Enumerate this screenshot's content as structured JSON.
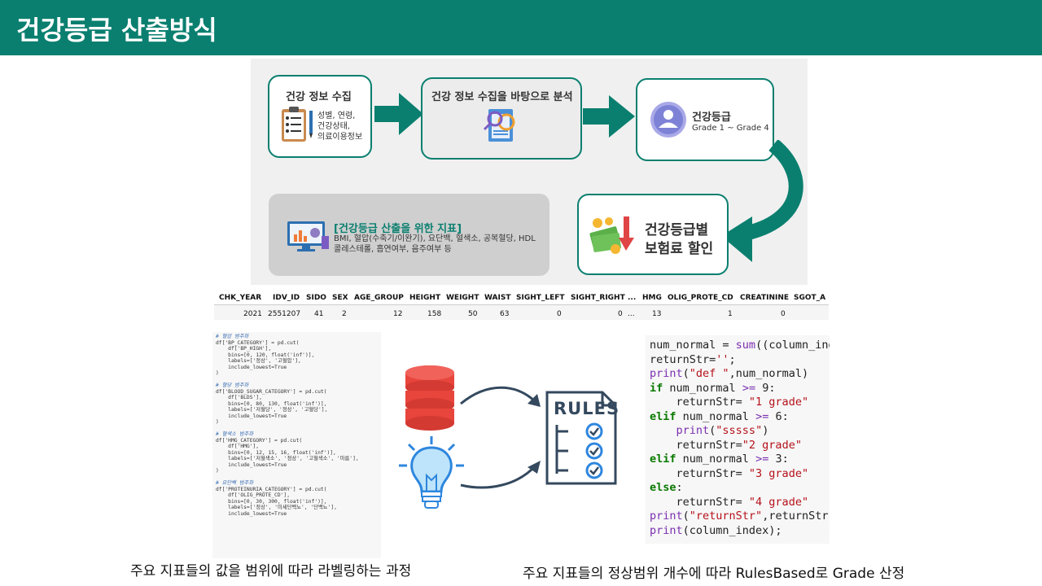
{
  "header": {
    "title": "건강등급 산출방식"
  },
  "flow": {
    "box1_title": "건강 정보 수집",
    "box1_lines": [
      "성별, 연령,",
      "건강상태,",
      "의료이용정보"
    ],
    "box2_title": "건강 정보 수집을 바탕으로 분석",
    "box3_title": "건강등급",
    "box3_sub": "Grade 1 ~ Grade 4",
    "box4_lines": [
      "건강등급별",
      "보험료 할인"
    ],
    "panel_title": "[건강등급 산출을 위한 지표]",
    "panel_lines": [
      "BMI, 혈압(수축기/이완기), 요단백, 혈색소, 공복혈당, HDL",
      "콜레스테롤, 흡연여부, 음주여부 등"
    ]
  },
  "table": {
    "headers": [
      "CHK_YEAR",
      "IDV_ID",
      "SIDO",
      "SEX",
      "AGE_GROUP",
      "HEIGHT",
      "WEIGHT",
      "WAIST",
      "SIGHT_LEFT",
      "SIGHT_RIGHT",
      "...",
      "HMG",
      "OLIG_PROTE_CD",
      "CREATININE",
      "SGOT_A"
    ],
    "row": [
      "2021",
      "2551207",
      "41",
      "2",
      "12",
      "158",
      "50",
      "63",
      "0",
      "0",
      "...",
      "13",
      "1",
      "0",
      ""
    ]
  },
  "code_left": [
    "# 혈압 범주화",
    "df['BP_CATEGORY'] = pd.cut(",
    "    df['BP_HIGH'],",
    "    bins=[0, 120, float('inf')],",
    "    labels=['정상', '고혈압'],",
    "    include_lowest=True",
    ")",
    "",
    "# 혈당 범주화",
    "df['BLOOD_SUGAR_CATEGORY'] = pd.cut(",
    "    df['BLDS'],",
    "    bins=[0, 80, 130, float('inf')],",
    "    labels=['저혈당', '정상', '고혈당'],",
    "    include_lowest=True",
    ")",
    "",
    "# 혈색소 범주화",
    "df['HMG_CATEGORY'] = pd.cut(",
    "    df['HMG'],",
    "    bins=[0, 12, 15, 16, float('inf')],",
    "    labels=['저혈색소', '정상', '고혈색소', '마름'],",
    "    include_lowest=True",
    ")",
    "",
    "# 요단백 범주화",
    "df['PROTEINURIA_CATEGORY'] = pd.cut(",
    "    df['OLIG_PROTE_CD'],",
    "    bins=[0, 30, 300, float('inf')],",
    "    labels=['정상', '미세단백뇨', '단백뇨'],",
    "    include_lowest=True"
  ],
  "code_right": [
    "num_normal = sum((column_index",
    "returnStr='';",
    "print(\"def \",num_normal)",
    "if num_normal >= 9:",
    "    returnStr= \"1 grade\"",
    "elif num_normal >= 6:",
    "    print(\"sssss\")",
    "    returnStr=\"2 grade\"",
    "elif num_normal >= 3:",
    "    returnStr= \"3 grade\"",
    "else:",
    "    returnStr= \"4 grade\"",
    "print(\"returnStr\",returnStr)",
    "print(column_index);"
  ],
  "rules_label": "RULES",
  "captions": {
    "left": "주요 지표들의 값을 범위에 따라 라벨링하는 과정",
    "right": "주요 지표들의 정상범위 개수에 따라 RulesBased로 Grade 산정"
  },
  "colors": {
    "brand": "#0a7f6f",
    "database": "#e8453c",
    "bulb": "#2e86de"
  }
}
